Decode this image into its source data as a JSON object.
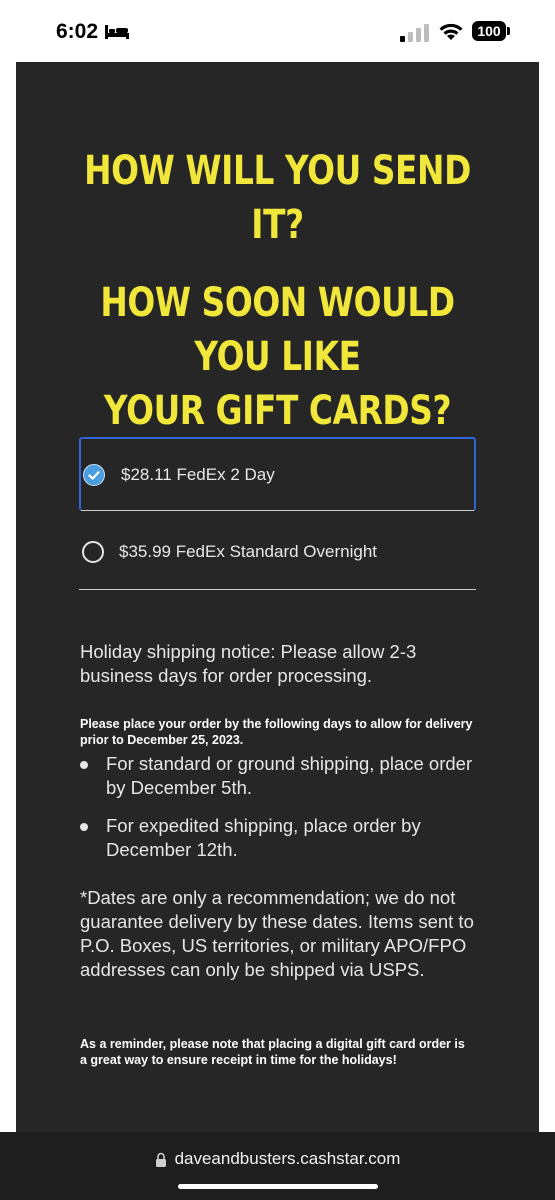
{
  "status_bar": {
    "time": "6:02",
    "battery": "100"
  },
  "headings": {
    "send": "HOW WILL YOU SEND IT?",
    "soon_line1": "HOW SOON WOULD YOU LIKE",
    "soon_line2": "YOUR GIFT CARDS?"
  },
  "shipping_options": [
    {
      "label": "$28.11 FedEx 2 Day",
      "selected": true
    },
    {
      "label": "$35.99 FedEx Standard Overnight",
      "selected": false
    }
  ],
  "notice": {
    "holiday": "Holiday shipping notice: Please allow 2-3 business days for order processing.",
    "deadline_intro": "Please place your order by the following days to allow for delivery prior to December 25, 2023.",
    "bullets": [
      "For standard or ground shipping, place order by December 5th.",
      "For expedited shipping, place order by December 12th."
    ],
    "disclaimer": "*Dates are only a recommendation; we do not guarantee delivery by these dates. Items sent to P.O. Boxes, US territories, or military APO/FPO addresses can only be shipped via USPS.",
    "reminder": "As a reminder, please note that placing a digital gift card order is a great way to ensure receipt in time for the holidays!"
  },
  "browser": {
    "url": "daveandbusters.cashstar.com"
  },
  "colors": {
    "panel_bg": "#262626",
    "heading_yellow": "#f1e63a",
    "focus_blue": "#2f65d6",
    "radio_checked": "#4a9ee0"
  }
}
